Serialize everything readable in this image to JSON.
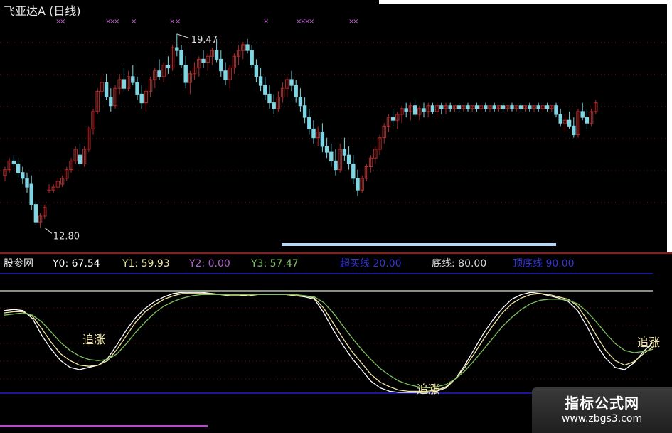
{
  "header": {
    "title": "飞亚达A",
    "period": "(日线)"
  },
  "price_labels": {
    "high": "19.47",
    "low": "12.80"
  },
  "indicator": {
    "name": "股参网",
    "y0_label": "Y0:",
    "y0_value": "67.54",
    "y1_label": "Y1:",
    "y1_value": "59.93",
    "y2_label": "Y2:",
    "y2_value": "0.00",
    "y3_label": "Y3:",
    "y3_value": "57.47",
    "line1_label": "超买线",
    "line1_value": "20.00",
    "line2_label": "底线:",
    "line2_value": "80.00",
    "line3_label": "顶底线",
    "line3_value": "90.00",
    "signal": "追涨"
  },
  "watermark": {
    "title": "指标公式网",
    "url": "www.zbgs3.com"
  },
  "colors": {
    "up": "#b02a2a",
    "down": "#7fd6e3",
    "y0": "#ffffff",
    "y1": "#f0e6a0",
    "y3": "#7fc060",
    "y2": "#b060c8",
    "purple_marks": "#c060d0",
    "band": "#2020c8",
    "level80": "#d8e6d0"
  },
  "chart_data": [
    {
      "type": "candlestick",
      "title": "飞亚达A (日线)",
      "ylim": [
        12.0,
        20.2
      ],
      "annotations": [
        {
          "x": 39,
          "value": 19.47,
          "label": "19.47"
        },
        {
          "x": 9,
          "value": 12.8,
          "label": "12.80"
        }
      ],
      "candles": [
        [
          14.6,
          14.9,
          14.4,
          14.8
        ],
        [
          14.8,
          15.2,
          14.7,
          15.1
        ],
        [
          15.1,
          15.3,
          14.9,
          15.0
        ],
        [
          15.0,
          15.2,
          14.5,
          14.7
        ],
        [
          14.7,
          14.9,
          14.3,
          14.5
        ],
        [
          14.5,
          14.7,
          14.0,
          14.2
        ],
        [
          14.3,
          14.6,
          13.4,
          13.6
        ],
        [
          13.6,
          13.7,
          12.9,
          13.0
        ],
        [
          13.0,
          13.3,
          12.8,
          13.2
        ],
        [
          13.2,
          13.6,
          13.1,
          13.5
        ],
        [
          14.1,
          14.3,
          14.0,
          14.1
        ],
        [
          14.1,
          14.3,
          14.0,
          14.2
        ],
        [
          14.2,
          14.5,
          14.1,
          14.4
        ],
        [
          14.3,
          14.6,
          14.2,
          14.5
        ],
        [
          14.5,
          14.9,
          14.4,
          14.8
        ],
        [
          14.8,
          15.2,
          14.7,
          15.1
        ],
        [
          15.1,
          15.6,
          15.0,
          15.5
        ],
        [
          15.3,
          15.7,
          14.9,
          15.0
        ],
        [
          15.0,
          15.6,
          14.9,
          15.5
        ],
        [
          15.5,
          16.3,
          15.4,
          16.2
        ],
        [
          16.2,
          16.9,
          16.0,
          16.8
        ],
        [
          16.8,
          17.6,
          16.7,
          17.5
        ],
        [
          17.5,
          18.0,
          17.3,
          17.8
        ],
        [
          17.8,
          18.1,
          17.2,
          17.3
        ],
        [
          17.3,
          17.6,
          16.8,
          17.0
        ],
        [
          17.0,
          17.7,
          16.9,
          17.6
        ],
        [
          17.6,
          18.1,
          17.4,
          17.9
        ],
        [
          17.9,
          18.3,
          17.5,
          17.6
        ],
        [
          17.6,
          18.2,
          17.5,
          18.0
        ],
        [
          18.0,
          18.4,
          17.7,
          17.8
        ],
        [
          17.8,
          18.0,
          17.2,
          17.4
        ],
        [
          17.4,
          17.7,
          16.9,
          17.1
        ],
        [
          17.1,
          17.6,
          16.8,
          17.5
        ],
        [
          17.5,
          18.0,
          17.3,
          17.9
        ],
        [
          17.9,
          18.3,
          17.6,
          18.2
        ],
        [
          18.2,
          18.6,
          17.9,
          18.0
        ],
        [
          18.0,
          18.5,
          17.8,
          18.4
        ],
        [
          18.4,
          18.7,
          18.1,
          18.3
        ],
        [
          18.3,
          19.1,
          18.2,
          19.0
        ],
        [
          19.0,
          19.47,
          18.7,
          18.9
        ],
        [
          18.9,
          19.1,
          18.3,
          18.4
        ],
        [
          18.4,
          18.7,
          17.6,
          17.8
        ],
        [
          17.8,
          18.2,
          17.4,
          18.1
        ],
        [
          18.1,
          18.5,
          17.9,
          18.3
        ],
        [
          18.3,
          18.7,
          18.0,
          18.6
        ],
        [
          18.6,
          18.9,
          18.3,
          18.5
        ],
        [
          18.5,
          18.8,
          18.2,
          18.7
        ],
        [
          18.7,
          19.0,
          18.4,
          18.9
        ],
        [
          18.9,
          19.3,
          18.5,
          18.6
        ],
        [
          18.6,
          18.9,
          18.0,
          18.2
        ],
        [
          18.2,
          18.5,
          17.7,
          17.9
        ],
        [
          17.9,
          18.4,
          17.6,
          18.3
        ],
        [
          18.3,
          18.8,
          18.1,
          18.7
        ],
        [
          18.7,
          19.1,
          18.4,
          18.9
        ],
        [
          18.9,
          19.2,
          18.6,
          19.1
        ],
        [
          19.1,
          19.3,
          18.8,
          18.9
        ],
        [
          18.9,
          19.1,
          18.3,
          18.4
        ],
        [
          18.4,
          18.6,
          17.8,
          18.0
        ],
        [
          18.0,
          18.3,
          17.5,
          17.7
        ],
        [
          17.7,
          18.0,
          17.2,
          17.4
        ],
        [
          17.4,
          17.7,
          16.9,
          17.1
        ],
        [
          17.1,
          17.4,
          16.7,
          16.9
        ],
        [
          16.9,
          17.5,
          16.8,
          17.3
        ],
        [
          17.3,
          17.8,
          17.1,
          17.6
        ],
        [
          17.6,
          18.0,
          17.3,
          17.9
        ],
        [
          17.9,
          18.2,
          17.5,
          17.7
        ],
        [
          17.7,
          17.9,
          17.1,
          17.3
        ],
        [
          17.3,
          17.6,
          16.8,
          17.0
        ],
        [
          17.0,
          17.3,
          16.4,
          16.6
        ],
        [
          16.6,
          16.9,
          16.0,
          16.2
        ],
        [
          16.2,
          16.5,
          15.7,
          15.9
        ],
        [
          15.9,
          16.3,
          15.6,
          16.1
        ],
        [
          16.1,
          16.4,
          15.4,
          15.6
        ],
        [
          15.6,
          15.9,
          15.2,
          15.4
        ],
        [
          15.4,
          15.7,
          14.9,
          15.1
        ],
        [
          15.1,
          15.5,
          14.6,
          14.8
        ],
        [
          14.8,
          15.7,
          14.7,
          15.5
        ],
        [
          15.5,
          15.9,
          15.1,
          15.3
        ],
        [
          15.3,
          15.6,
          14.8,
          15.0
        ],
        [
          15.0,
          15.3,
          14.3,
          14.5
        ],
        [
          14.5,
          14.8,
          13.9,
          14.1
        ],
        [
          14.1,
          14.6,
          14.0,
          14.5
        ],
        [
          14.5,
          15.0,
          14.4,
          14.9
        ],
        [
          14.9,
          15.3,
          14.7,
          15.2
        ],
        [
          15.2,
          15.6,
          15.0,
          15.5
        ],
        [
          15.5,
          16.0,
          15.3,
          15.9
        ],
        [
          15.9,
          16.4,
          15.7,
          16.3
        ],
        [
          16.3,
          16.7,
          16.1,
          16.6
        ],
        [
          16.6,
          16.9,
          16.3,
          16.5
        ],
        [
          16.5,
          16.8,
          16.2,
          16.7
        ],
        [
          16.7,
          17.0,
          16.4,
          16.9
        ],
        [
          16.9,
          17.1,
          16.6,
          16.8
        ],
        [
          16.8,
          17.1,
          16.5,
          17.0
        ],
        [
          17.0,
          17.2,
          16.6,
          16.7
        ],
        [
          16.7,
          17.0,
          16.5,
          16.9
        ],
        [
          16.9,
          17.1,
          16.6,
          16.8
        ],
        [
          16.8,
          17.1,
          16.6,
          17.0
        ],
        [
          17.0,
          17.1,
          16.7,
          16.8
        ],
        [
          16.8,
          17.1,
          16.6,
          17.0
        ],
        [
          17.0,
          17.1,
          16.7,
          16.9
        ],
        [
          16.9,
          17.1,
          16.7,
          17.0
        ],
        [
          17.0,
          17.1,
          16.8,
          16.9
        ],
        [
          16.9,
          17.0,
          16.8,
          17.0
        ],
        [
          17.0,
          17.1,
          16.8,
          16.9
        ],
        [
          16.9,
          17.0,
          16.8,
          17.0
        ],
        [
          17.0,
          17.1,
          16.8,
          16.9
        ],
        [
          16.9,
          17.0,
          16.8,
          17.0
        ],
        [
          17.0,
          17.1,
          16.8,
          16.9
        ],
        [
          16.9,
          17.0,
          16.8,
          17.0
        ],
        [
          17.0,
          17.1,
          16.8,
          16.9
        ],
        [
          16.9,
          17.0,
          16.8,
          17.0
        ],
        [
          17.0,
          17.1,
          16.8,
          16.9
        ],
        [
          16.9,
          17.0,
          16.8,
          17.0
        ],
        [
          17.0,
          17.1,
          16.8,
          16.9
        ],
        [
          16.9,
          17.0,
          16.8,
          17.0
        ],
        [
          17.0,
          17.1,
          16.8,
          16.9
        ],
        [
          16.9,
          17.0,
          16.8,
          17.0
        ],
        [
          17.0,
          17.1,
          16.8,
          16.9
        ],
        [
          16.9,
          17.0,
          16.8,
          17.0
        ],
        [
          17.0,
          17.1,
          16.8,
          16.9
        ],
        [
          16.9,
          17.0,
          16.8,
          17.0
        ],
        [
          17.0,
          17.1,
          16.8,
          16.9
        ],
        [
          16.9,
          17.0,
          16.8,
          17.0
        ],
        [
          17.0,
          17.1,
          16.8,
          16.9
        ],
        [
          16.9,
          17.0,
          16.8,
          17.0
        ],
        [
          17.0,
          17.1,
          16.6,
          16.7
        ],
        [
          16.7,
          16.9,
          16.3,
          16.4
        ],
        [
          16.4,
          16.7,
          16.1,
          16.5
        ],
        [
          16.5,
          16.8,
          16.2,
          16.3
        ],
        [
          16.3,
          16.6,
          15.9,
          16.0
        ],
        [
          16.0,
          16.9,
          15.9,
          16.8
        ],
        [
          16.8,
          17.1,
          16.5,
          16.6
        ],
        [
          16.6,
          16.9,
          16.2,
          16.4
        ],
        [
          16.4,
          16.9,
          16.3,
          16.8
        ],
        [
          16.8,
          17.2,
          16.7,
          17.1
        ]
      ]
    },
    {
      "type": "line",
      "ylim": [
        0,
        100
      ],
      "reference_lines": [
        20.0,
        80.0,
        90.0
      ],
      "series": [
        {
          "name": "Y0",
          "values": [
            72,
            73,
            72,
            65,
            50,
            38,
            28,
            22,
            20,
            22,
            24,
            30,
            42,
            55,
            66,
            74,
            80,
            84,
            87,
            88,
            88,
            88,
            87,
            86,
            85,
            85,
            86,
            86,
            86,
            86,
            86,
            85,
            84,
            82,
            70,
            55,
            42,
            30,
            20,
            10,
            4,
            1,
            0,
            0,
            0,
            0,
            1,
            4,
            12,
            24,
            38,
            52,
            64,
            74,
            82,
            86,
            88,
            87,
            85,
            83,
            80,
            72,
            58,
            42,
            30,
            22,
            20,
            26,
            36,
            44
          ]
        },
        {
          "name": "Y1",
          "values": [
            70,
            71,
            71,
            67,
            56,
            44,
            34,
            28,
            24,
            23,
            24,
            28,
            38,
            50,
            62,
            71,
            77,
            82,
            85,
            87,
            87,
            87,
            87,
            86,
            85,
            85,
            85,
            86,
            86,
            86,
            86,
            85,
            85,
            83,
            74,
            61,
            48,
            36,
            26,
            16,
            9,
            5,
            2,
            1,
            1,
            1,
            2,
            5,
            12,
            22,
            34,
            47,
            59,
            70,
            78,
            83,
            86,
            87,
            86,
            84,
            82,
            76,
            64,
            50,
            37,
            28,
            24,
            27,
            34,
            40
          ]
        },
        {
          "name": "Y3",
          "values": [
            68,
            69,
            70,
            68,
            62,
            53,
            44,
            37,
            32,
            29,
            28,
            29,
            34,
            43,
            53,
            62,
            70,
            76,
            80,
            83,
            85,
            86,
            86,
            86,
            86,
            86,
            86,
            86,
            86,
            86,
            86,
            86,
            85,
            84,
            79,
            70,
            59,
            48,
            38,
            29,
            21,
            15,
            10,
            7,
            5,
            4,
            5,
            7,
            12,
            19,
            28,
            38,
            48,
            58,
            66,
            73,
            78,
            81,
            82,
            82,
            81,
            78,
            71,
            62,
            52,
            43,
            37,
            35,
            36,
            38
          ]
        }
      ]
    }
  ]
}
